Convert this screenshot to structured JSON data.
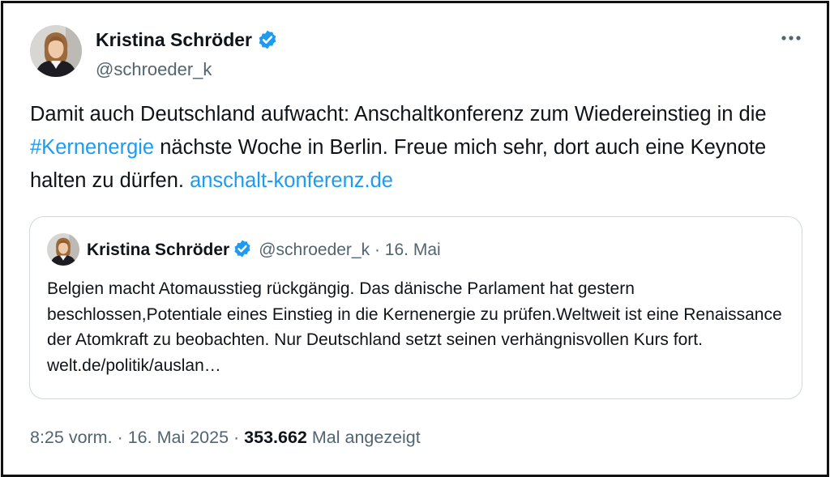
{
  "tweet": {
    "author": {
      "name": "Kristina Schröder",
      "handle": "@schroeder_k",
      "verified": true,
      "avatar_icon": "portrait-avatar"
    },
    "text": {
      "part1": "Damit auch Deutschland aufwacht: Anschaltkonferenz zum Wiedereinstieg in die ",
      "hashtag": "#Kernenergie",
      "part2": " nächste Woche in Berlin. Freue mich sehr, dort auch eine Keynote halten zu dürfen. ",
      "link": "anschalt-konferenz.de"
    },
    "more_icon": "more-horizontal-icon",
    "accent_color": "#1d9bf0"
  },
  "quote": {
    "author": {
      "name": "Kristina Schröder",
      "handle": "@schroeder_k",
      "separator": "·",
      "date": "16. Mai",
      "verified": true
    },
    "text": "Belgien macht Atomausstieg rückgängig. Das dänische Parlament hat gestern beschlossen,Potentiale eines Einstieg in die Kernenergie zu prüfen.Weltweit ist eine Renaissance der Atomkraft zu beobachten. Nur Deutschland setzt seinen verhängnisvollen Kurs fort. welt.de/politik/auslan…"
  },
  "meta": {
    "time": "8:25 vorm.",
    "separator": "·",
    "date": "16. Mai 2025",
    "views_count": "353.662",
    "views_label": "Mal angezeigt"
  }
}
